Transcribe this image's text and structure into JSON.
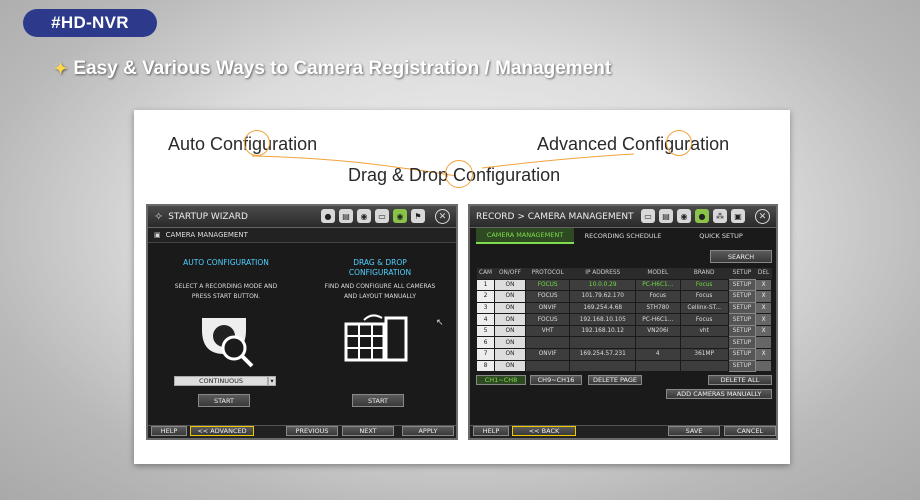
{
  "tag": "#HD-NVR",
  "headline": "Easy & Various Ways to Camera Registration / Management",
  "labels": {
    "auto": "Auto Configuration",
    "advanced": "Advanced Configuration",
    "dragdrop": "Drag & Drop Configuration"
  },
  "wizard": {
    "title": "STARTUP WIZARD",
    "subtitle": "CAMERA MANAGEMENT",
    "auto_title": "AUTO CONFIGURATION",
    "auto_desc": "SELECT A RECORDING MODE AND PRESS START BUTTON.",
    "drag_title": "DRAG & DROP CONFIGURATION",
    "drag_desc": "FIND AND CONFIGURE ALL CAMERAS AND LAYOUT MANUALLY",
    "mode_value": "CONTINUOUS",
    "start": "START",
    "help": "HELP",
    "advanced": "<< ADVANCED",
    "previous": "PREVIOUS",
    "next": "NEXT",
    "apply": "APPLY"
  },
  "record": {
    "title": "RECORD > CAMERA MANAGEMENT",
    "tabs": [
      "CAMERA MANAGEMENT",
      "RECORDING SCHEDULE",
      "QUICK SETUP"
    ],
    "search": "SEARCH",
    "columns": [
      "CAM",
      "ON/OFF",
      "PROTOCOL",
      "IP ADDRESS",
      "MODEL",
      "BRAND",
      "SETUP",
      "DEL"
    ],
    "rows": [
      {
        "cam": "1",
        "on": "ON",
        "protocol": "FOCUS",
        "ip": "10.0.0.29",
        "model": "PC-H6C1...",
        "brand": "Focus",
        "setup": "SETUP",
        "del": "X",
        "green": true
      },
      {
        "cam": "2",
        "on": "ON",
        "protocol": "FOCUS",
        "ip": "101.79.62.170",
        "model": "Focus",
        "brand": "Focus",
        "setup": "SETUP",
        "del": "X",
        "green": false
      },
      {
        "cam": "3",
        "on": "ON",
        "protocol": "ONVIF",
        "ip": "169.254.4.68",
        "model": "STH780",
        "brand": "Cellinx-ST...",
        "setup": "SETUP",
        "del": "X",
        "green": false
      },
      {
        "cam": "4",
        "on": "ON",
        "protocol": "FOCUS",
        "ip": "192.168.10.105",
        "model": "PC-H6C1...",
        "brand": "Focus",
        "setup": "SETUP",
        "del": "X",
        "green": false
      },
      {
        "cam": "5",
        "on": "ON",
        "protocol": "VHT",
        "ip": "192.168.10.12",
        "model": "VN206i",
        "brand": "vht",
        "setup": "SETUP",
        "del": "X",
        "green": false
      },
      {
        "cam": "6",
        "on": "ON",
        "protocol": "",
        "ip": "",
        "model": "",
        "brand": "",
        "setup": "SETUP",
        "del": "",
        "green": false
      },
      {
        "cam": "7",
        "on": "ON",
        "protocol": "ONVIF",
        "ip": "169.254.57.231",
        "model": "4",
        "brand": "361MP",
        "setup": "SETUP",
        "del": "X",
        "green": false
      },
      {
        "cam": "8",
        "on": "ON",
        "protocol": "",
        "ip": "",
        "model": "",
        "brand": "",
        "setup": "SETUP",
        "del": "",
        "green": false
      }
    ],
    "ch1": "CH1~CH8",
    "ch9": "CH9~CH16",
    "delete_page": "DELETE PAGE",
    "delete_all": "DELETE ALL",
    "add_manual": "ADD CAMERAS MANUALLY",
    "help": "HELP",
    "back": "<< BACK",
    "save": "SAVE",
    "cancel": "CANCEL"
  },
  "colors": {
    "tag_bg": "#2d3a8c",
    "ring": "#f3a23a",
    "accent_green": "#7fdc4f",
    "accent_cyan": "#4fd0ff"
  }
}
